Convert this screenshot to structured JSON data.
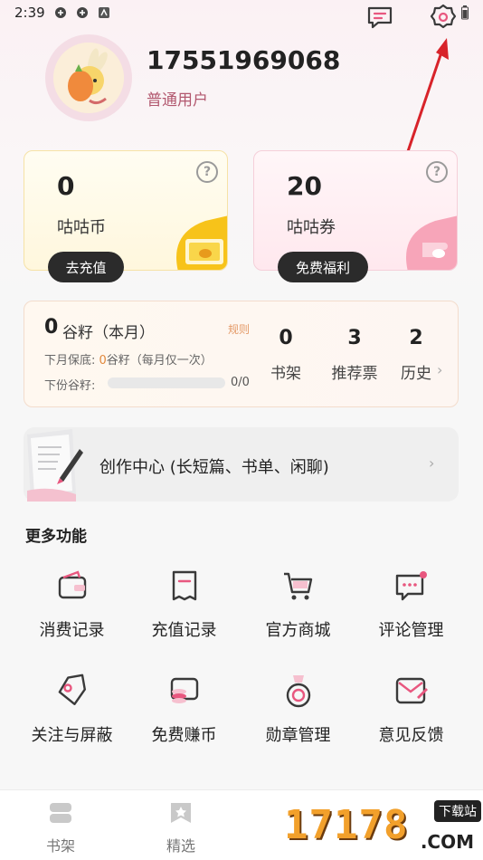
{
  "status_bar": {
    "time": "2:39"
  },
  "profile": {
    "phone": "17551969068",
    "role": "普通用户"
  },
  "cards": {
    "coin": {
      "value": "0",
      "label": "咕咕币",
      "help": "?",
      "button": "去充值"
    },
    "coupon": {
      "value": "20",
      "label": "咕咕券",
      "help": "?",
      "button": "免费福利"
    }
  },
  "grain": {
    "value": "0",
    "label": "谷籽（本月）",
    "rule": "规则",
    "line1_prefix": "下月保底: ",
    "line1_value": "0",
    "line1_suffix": "谷籽（每月仅一次）",
    "line2_label": "下份谷籽:",
    "progress_fraction": 0,
    "progress_text": "0/0",
    "stats": [
      {
        "value": "0",
        "label": "书架"
      },
      {
        "value": "3",
        "label": "推荐票"
      },
      {
        "value": "2",
        "label": "历史"
      }
    ]
  },
  "create_center": {
    "label": "创作中心 (长短篇、书单、闲聊)"
  },
  "more": {
    "title": "更多功能",
    "items": [
      {
        "label": "消费记录",
        "icon": "wallet-icon"
      },
      {
        "label": "充值记录",
        "icon": "receipt-icon"
      },
      {
        "label": "官方商城",
        "icon": "cart-icon"
      },
      {
        "label": "评论管理",
        "icon": "comment-icon"
      },
      {
        "label": "关注与屏蔽",
        "icon": "tag-icon"
      },
      {
        "label": "免费赚币",
        "icon": "coins-icon"
      },
      {
        "label": "勋章管理",
        "icon": "medal-icon"
      },
      {
        "label": "意见反馈",
        "icon": "feedback-icon"
      }
    ]
  },
  "tabbar": {
    "items": [
      {
        "label": "书架",
        "icon": "bookshelf-icon"
      },
      {
        "label": "精选",
        "icon": "featured-icon"
      }
    ]
  },
  "watermark": {
    "text": "17178",
    "badge": "下载站",
    "sub": ".COM"
  },
  "colors": {
    "accent_pink": "#e8577f",
    "role_text": "#b2586f",
    "orange": "#e0883c"
  }
}
